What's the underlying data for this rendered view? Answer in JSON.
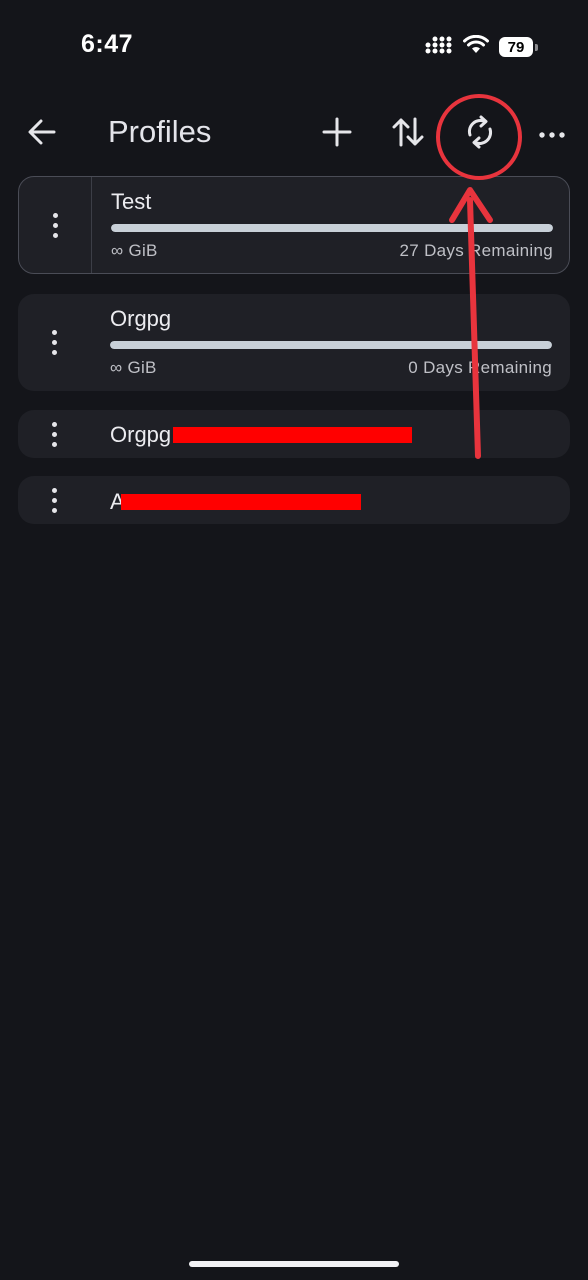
{
  "status_bar": {
    "time": "6:47",
    "battery": "79",
    "signal_icon": "cellular-signal-icon",
    "wifi_icon": "wifi-icon"
  },
  "header": {
    "title": "Profiles",
    "back_icon": "arrow-left-icon",
    "add_icon": "plus-icon",
    "sort_icon": "sort-arrows-icon",
    "refresh_icon": "refresh-icon",
    "more_icon": "more-horizontal-icon"
  },
  "profiles": [
    {
      "name": "Test",
      "usage": "∞ GiB",
      "remaining": "27 Days Remaining",
      "usage_fraction": 1.0,
      "selected": true
    },
    {
      "name": "Orgpg",
      "usage": "∞ GiB",
      "remaining": "0 Days Remaining",
      "usage_fraction": 1.0,
      "selected": false
    },
    {
      "name": "Orgpg",
      "selected": false
    },
    {
      "name": "A",
      "selected": false
    }
  ],
  "colors": {
    "background": "#14151a",
    "card": "#1f2026",
    "progress_fill": "#c8d0d8",
    "annotation": "#e8343d",
    "redaction": "#ff0000"
  }
}
